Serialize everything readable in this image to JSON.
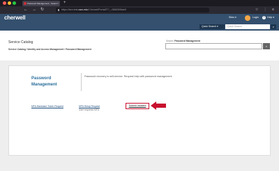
{
  "browser": {
    "tab_title": "Password Management - Select",
    "tab_close": "×",
    "new_tab": "+",
    "url_prefix": "https://tsm.test.",
    "url_domain": "osm.edu",
    "url_rest": "/CherwellPortal/IT?_=5582606ae9",
    "back": "←",
    "forward": "→",
    "reload": "↻",
    "right_icons": "☆ ⋮ ≡"
  },
  "header": {
    "logo": "cherwell",
    "user_label": "Sites ▾",
    "login_label": "Login",
    "help_label": "Help ▾",
    "help_icon": "?"
  },
  "quick_search": {
    "button_label": "Quick Search",
    "button_caret": "▾",
    "placeholder": "Quick Search",
    "search_icon": "⌕"
  },
  "catalog": {
    "title": "Service Catalog",
    "breadcrumb": "Service Catalog / Identity and Access Management / Password Management",
    "search_label_prefix": "Search:",
    "search_label_value": "Password Management",
    "search_icon": "⌕"
  },
  "service": {
    "title": "Password Management",
    "description": "Password recovery is self-service. Request help with password management.",
    "link_hardware_token": "MFA Hardware Token Request",
    "link_mfa_setup": "MFA Setup Request",
    "link_mfa_setup_sub": "User requests MFA",
    "submit_label": "Submit Incident"
  },
  "colors": {
    "header_bg": "#34506e",
    "accent_red": "#c8102e",
    "title_blue": "#2a6e9b"
  }
}
